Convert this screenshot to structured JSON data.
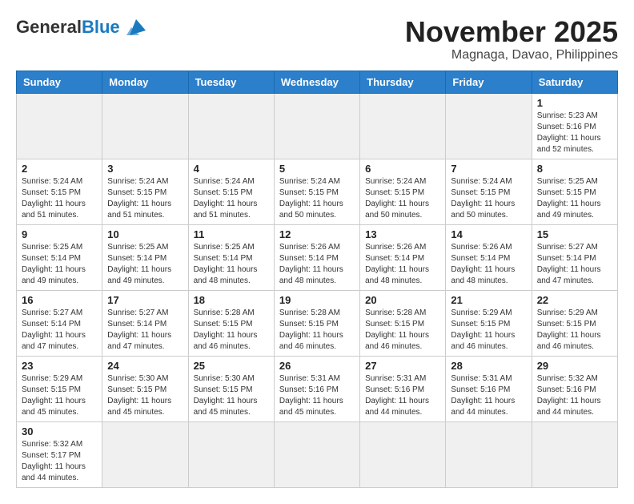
{
  "header": {
    "logo_general": "General",
    "logo_blue": "Blue",
    "month_title": "November 2025",
    "location": "Magnaga, Davao, Philippines"
  },
  "days_of_week": [
    "Sunday",
    "Monday",
    "Tuesday",
    "Wednesday",
    "Thursday",
    "Friday",
    "Saturday"
  ],
  "weeks": [
    [
      {
        "day": "",
        "empty": true
      },
      {
        "day": "",
        "empty": true
      },
      {
        "day": "",
        "empty": true
      },
      {
        "day": "",
        "empty": true
      },
      {
        "day": "",
        "empty": true
      },
      {
        "day": "",
        "empty": true
      },
      {
        "day": "1",
        "sunrise": "5:23 AM",
        "sunset": "5:16 PM",
        "daylight": "11 hours and 52 minutes."
      }
    ],
    [
      {
        "day": "2",
        "sunrise": "5:24 AM",
        "sunset": "5:15 PM",
        "daylight": "11 hours and 51 minutes."
      },
      {
        "day": "3",
        "sunrise": "5:24 AM",
        "sunset": "5:15 PM",
        "daylight": "11 hours and 51 minutes."
      },
      {
        "day": "4",
        "sunrise": "5:24 AM",
        "sunset": "5:15 PM",
        "daylight": "11 hours and 51 minutes."
      },
      {
        "day": "5",
        "sunrise": "5:24 AM",
        "sunset": "5:15 PM",
        "daylight": "11 hours and 50 minutes."
      },
      {
        "day": "6",
        "sunrise": "5:24 AM",
        "sunset": "5:15 PM",
        "daylight": "11 hours and 50 minutes."
      },
      {
        "day": "7",
        "sunrise": "5:24 AM",
        "sunset": "5:15 PM",
        "daylight": "11 hours and 50 minutes."
      },
      {
        "day": "8",
        "sunrise": "5:25 AM",
        "sunset": "5:15 PM",
        "daylight": "11 hours and 49 minutes."
      }
    ],
    [
      {
        "day": "9",
        "sunrise": "5:25 AM",
        "sunset": "5:14 PM",
        "daylight": "11 hours and 49 minutes."
      },
      {
        "day": "10",
        "sunrise": "5:25 AM",
        "sunset": "5:14 PM",
        "daylight": "11 hours and 49 minutes."
      },
      {
        "day": "11",
        "sunrise": "5:25 AM",
        "sunset": "5:14 PM",
        "daylight": "11 hours and 48 minutes."
      },
      {
        "day": "12",
        "sunrise": "5:26 AM",
        "sunset": "5:14 PM",
        "daylight": "11 hours and 48 minutes."
      },
      {
        "day": "13",
        "sunrise": "5:26 AM",
        "sunset": "5:14 PM",
        "daylight": "11 hours and 48 minutes."
      },
      {
        "day": "14",
        "sunrise": "5:26 AM",
        "sunset": "5:14 PM",
        "daylight": "11 hours and 48 minutes."
      },
      {
        "day": "15",
        "sunrise": "5:27 AM",
        "sunset": "5:14 PM",
        "daylight": "11 hours and 47 minutes."
      }
    ],
    [
      {
        "day": "16",
        "sunrise": "5:27 AM",
        "sunset": "5:14 PM",
        "daylight": "11 hours and 47 minutes."
      },
      {
        "day": "17",
        "sunrise": "5:27 AM",
        "sunset": "5:14 PM",
        "daylight": "11 hours and 47 minutes."
      },
      {
        "day": "18",
        "sunrise": "5:28 AM",
        "sunset": "5:15 PM",
        "daylight": "11 hours and 46 minutes."
      },
      {
        "day": "19",
        "sunrise": "5:28 AM",
        "sunset": "5:15 PM",
        "daylight": "11 hours and 46 minutes."
      },
      {
        "day": "20",
        "sunrise": "5:28 AM",
        "sunset": "5:15 PM",
        "daylight": "11 hours and 46 minutes."
      },
      {
        "day": "21",
        "sunrise": "5:29 AM",
        "sunset": "5:15 PM",
        "daylight": "11 hours and 46 minutes."
      },
      {
        "day": "22",
        "sunrise": "5:29 AM",
        "sunset": "5:15 PM",
        "daylight": "11 hours and 46 minutes."
      }
    ],
    [
      {
        "day": "23",
        "sunrise": "5:29 AM",
        "sunset": "5:15 PM",
        "daylight": "11 hours and 45 minutes."
      },
      {
        "day": "24",
        "sunrise": "5:30 AM",
        "sunset": "5:15 PM",
        "daylight": "11 hours and 45 minutes."
      },
      {
        "day": "25",
        "sunrise": "5:30 AM",
        "sunset": "5:15 PM",
        "daylight": "11 hours and 45 minutes."
      },
      {
        "day": "26",
        "sunrise": "5:31 AM",
        "sunset": "5:16 PM",
        "daylight": "11 hours and 45 minutes."
      },
      {
        "day": "27",
        "sunrise": "5:31 AM",
        "sunset": "5:16 PM",
        "daylight": "11 hours and 44 minutes."
      },
      {
        "day": "28",
        "sunrise": "5:31 AM",
        "sunset": "5:16 PM",
        "daylight": "11 hours and 44 minutes."
      },
      {
        "day": "29",
        "sunrise": "5:32 AM",
        "sunset": "5:16 PM",
        "daylight": "11 hours and 44 minutes."
      }
    ],
    [
      {
        "day": "30",
        "sunrise": "5:32 AM",
        "sunset": "5:17 PM",
        "daylight": "11 hours and 44 minutes."
      },
      {
        "day": "",
        "empty": true
      },
      {
        "day": "",
        "empty": true
      },
      {
        "day": "",
        "empty": true
      },
      {
        "day": "",
        "empty": true
      },
      {
        "day": "",
        "empty": true
      },
      {
        "day": "",
        "empty": true
      }
    ]
  ]
}
